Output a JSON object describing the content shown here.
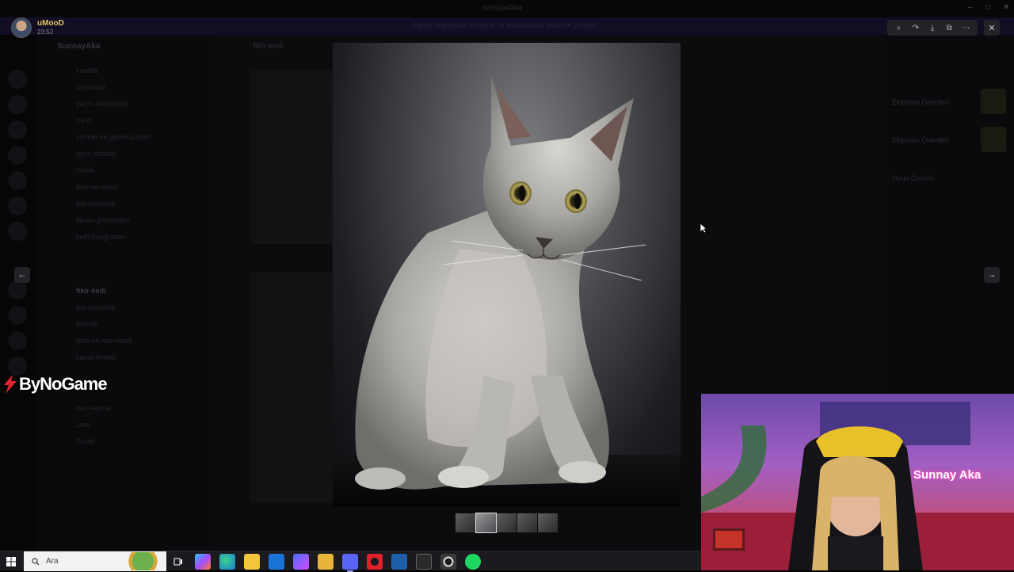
{
  "window": {
    "title": "NormalAka",
    "controls": [
      "–",
      "□",
      "✕"
    ]
  },
  "banner": {
    "text": "Kişisel bilgilerinizi koruyun ve sunucunuzu güvenle yönetin"
  },
  "sidebar": {
    "server_name": "SunnayAka",
    "channels": [
      {
        "label": "kurallar"
      },
      {
        "label": "duyurular"
      },
      {
        "label": "yayın-bildirimleri"
      },
      {
        "label": "rol-al"
      },
      {
        "label": "sohbet-ve-genel-sohbet"
      },
      {
        "label": "oyun-sohbet"
      },
      {
        "label": "müzik"
      },
      {
        "label": "foto-ve-video"
      },
      {
        "label": "bot-komutlar"
      },
      {
        "label": "ekran-görüntüleri"
      },
      {
        "label": "kedi-fotoğrafları"
      },
      {
        "label": "fikir-kedi",
        "active": true
      },
      {
        "label": "bot-komutlar"
      },
      {
        "label": "etkinlik"
      },
      {
        "label": "güle-ve-nav-hazık"
      },
      {
        "label": "kanal-dostas"
      },
      {
        "label": "dev-sayına"
      },
      {
        "label": "Lobi"
      },
      {
        "label": "Genel"
      }
    ]
  },
  "chat": {
    "channel_title": "fikir-kedi"
  },
  "right_panel": {
    "threads": [
      {
        "label": "Ekipman Önerileri"
      },
      {
        "label": "Ekipman Önerileri"
      },
      {
        "label": "Oyun Önerisi"
      }
    ]
  },
  "viewer": {
    "user": {
      "name": "uMooD",
      "time": "23:52"
    },
    "toolbar_icons": [
      "zoom-icon",
      "forward-icon",
      "download-icon",
      "open-external-icon",
      "more-icon"
    ],
    "toolbar_glyphs": [
      "⌕",
      "↷",
      "⤓",
      "⧉",
      "⋯"
    ],
    "close_glyph": "✕",
    "prev_glyph": "←",
    "next_glyph": "→",
    "thumbnail_count": 5,
    "selected_thumbnail": 2
  },
  "overlay": {
    "logo_text": "ByNoGame",
    "webcam_sign": "Sunnay Aka"
  },
  "taskbar": {
    "search_placeholder": "Ara",
    "apps": [
      "task-view",
      "copilot",
      "edge",
      "store",
      "mail",
      "loop",
      "explorer",
      "discord",
      "opera",
      "steam",
      "epic-games",
      "obs",
      "spotify"
    ]
  },
  "colors": {
    "viewer_button_bg": "#232327",
    "username_color": "#e4c76a",
    "taskbar_bg": "#1b1b1f",
    "webcam_glow": "#ff4fc8"
  }
}
